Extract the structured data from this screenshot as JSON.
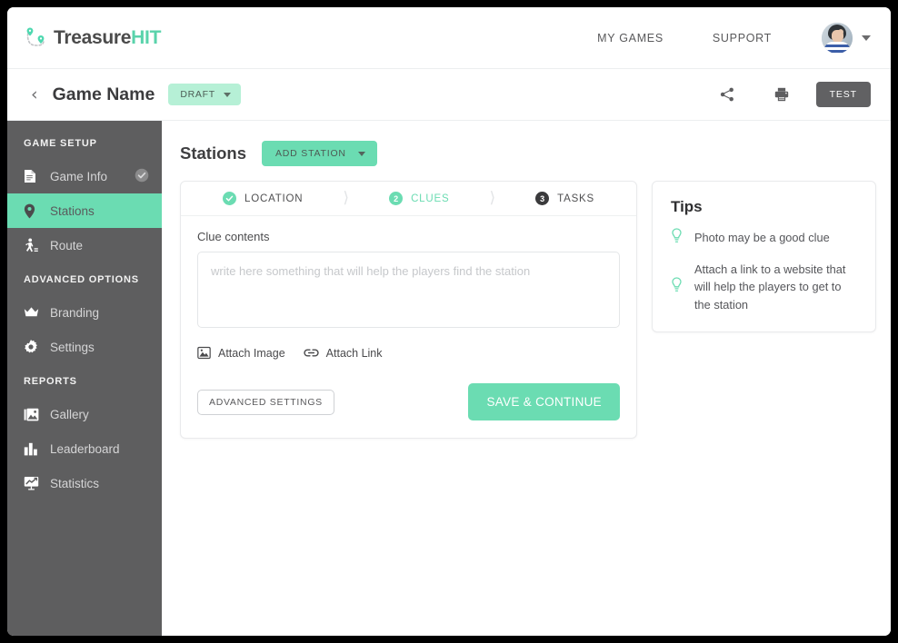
{
  "header": {
    "logo_text_main": "Treasure",
    "logo_text_accent": "HIT",
    "logo_icon": "treasure-map-pins-icon",
    "nav": [
      {
        "label": "MY GAMES",
        "name": "my-games"
      },
      {
        "label": "SUPPORT",
        "name": "support"
      }
    ],
    "avatar_icon": "user-avatar",
    "avatar_caret_icon": "chevron-down-icon"
  },
  "subheader": {
    "back_icon": "chevron-left-icon",
    "title": "Game Name",
    "status_badge": "DRAFT",
    "status_caret_icon": "chevron-down-icon",
    "share_icon": "share-icon",
    "print_icon": "print-icon",
    "test_label": "TEST"
  },
  "sidebar": {
    "sections": [
      {
        "title": "GAME SETUP",
        "items": [
          {
            "label": "Game Info",
            "icon": "document-icon",
            "active": false,
            "completed": true
          },
          {
            "label": "Stations",
            "icon": "map-pin-icon",
            "active": true,
            "completed": false
          },
          {
            "label": "Route",
            "icon": "walking-person-icon",
            "active": false,
            "completed": false
          }
        ]
      },
      {
        "title": "ADVANCED OPTIONS",
        "items": [
          {
            "label": "Branding",
            "icon": "crown-icon",
            "active": false,
            "completed": false
          },
          {
            "label": "Settings",
            "icon": "gear-icon",
            "active": false,
            "completed": false
          }
        ]
      },
      {
        "title": "REPORTS",
        "items": [
          {
            "label": "Gallery",
            "icon": "photo-gallery-icon",
            "active": false,
            "completed": false
          },
          {
            "label": "Leaderboard",
            "icon": "bar-chart-icon",
            "active": false,
            "completed": false
          },
          {
            "label": "Statistics",
            "icon": "statistics-chart-icon",
            "active": false,
            "completed": false
          }
        ]
      }
    ]
  },
  "main": {
    "title": "Stations",
    "add_station_label": "ADD STATION",
    "add_station_caret_icon": "chevron-down-icon",
    "steps": [
      {
        "label": "LOCATION",
        "state": "done",
        "marker": "check",
        "name": "location"
      },
      {
        "label": "CLUES",
        "state": "active",
        "marker": "2",
        "name": "clues"
      },
      {
        "label": "TASKS",
        "state": "todo",
        "marker": "3",
        "name": "tasks"
      }
    ],
    "form": {
      "field_label": "Clue contents",
      "textarea_value": "",
      "textarea_placeholder": "write here something that will help the players find the station",
      "attach_image_label": "Attach Image",
      "attach_image_icon": "image-icon",
      "attach_link_label": "Attach Link",
      "attach_link_icon": "link-icon",
      "advanced_settings_label": "ADVANCED SETTINGS",
      "save_label": "SAVE & CONTINUE"
    }
  },
  "tips": {
    "title": "Tips",
    "items": [
      {
        "text": "Photo may be a good clue",
        "icon": "lightbulb-icon"
      },
      {
        "text": "Attach a link to a website that will help the players to get to the station",
        "icon": "lightbulb-icon"
      }
    ]
  },
  "colors": {
    "accent_green": "#6bdcb2",
    "badge_green": "#b6f0d6",
    "sidebar_gray": "#5e5e5f",
    "dark_button": "#616163"
  }
}
